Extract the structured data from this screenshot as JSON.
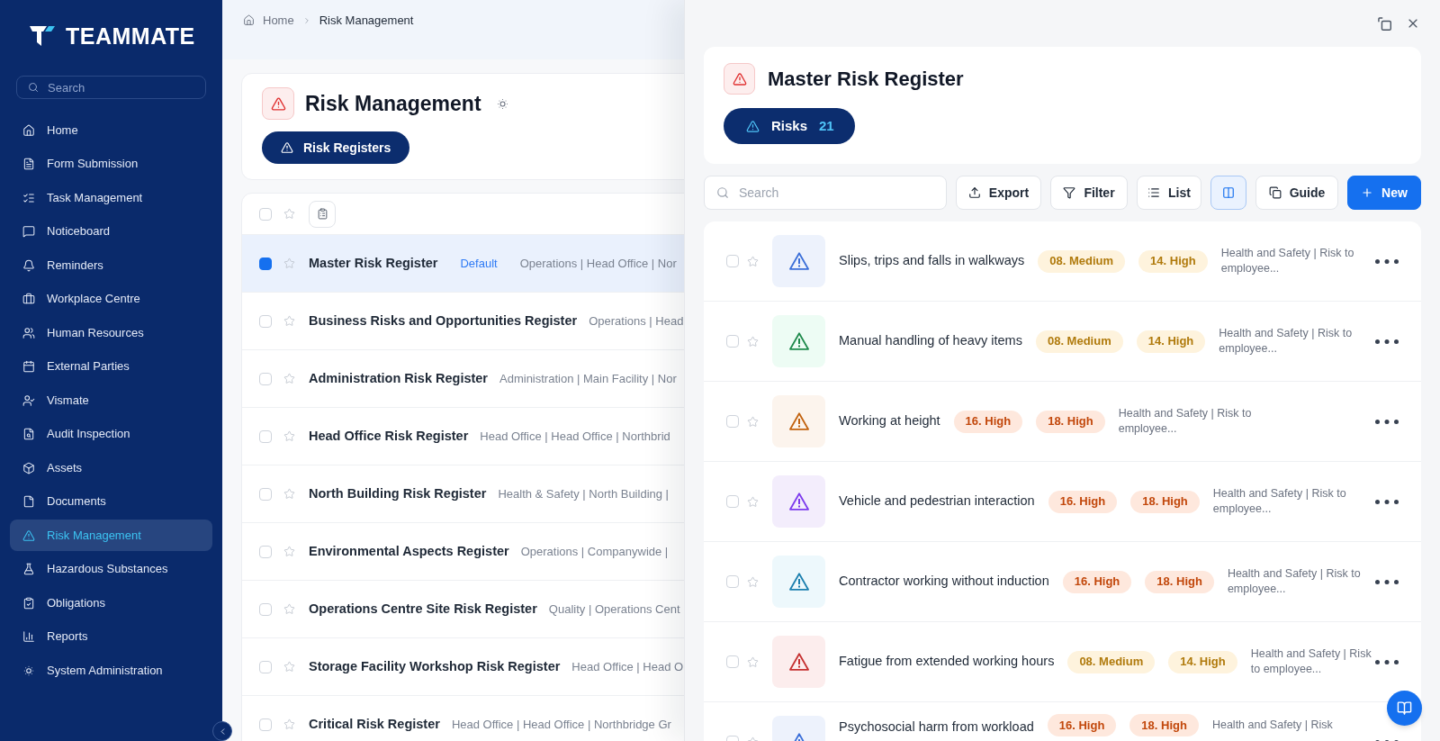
{
  "sidebar": {
    "logo": "TEAMMATE",
    "search": {
      "placeholder": "Search"
    },
    "items": [
      {
        "label": "Home",
        "selected": false
      },
      {
        "label": "Form Submission",
        "selected": false
      },
      {
        "label": "Task Management",
        "selected": false
      },
      {
        "label": "Noticeboard",
        "selected": false
      },
      {
        "label": "Reminders",
        "selected": false
      },
      {
        "label": "Workplace Centre",
        "selected": false
      },
      {
        "label": "Human Resources",
        "selected": false
      },
      {
        "label": "External Parties",
        "selected": false
      },
      {
        "label": "Vismate",
        "selected": false
      },
      {
        "label": "Audit Inspection",
        "selected": false
      },
      {
        "label": "Assets",
        "selected": false
      },
      {
        "label": "Documents",
        "selected": false
      },
      {
        "label": "Risk Management",
        "selected": true
      },
      {
        "label": "Hazardous Substances",
        "selected": false
      },
      {
        "label": "Obligations",
        "selected": false
      },
      {
        "label": "Reports",
        "selected": false
      },
      {
        "label": "System Administration",
        "selected": false
      }
    ]
  },
  "breadcrumbs": [
    "Home",
    "Risk Management"
  ],
  "page_header": {
    "title": "Risk Management",
    "tabs": [
      {
        "label": "Risk Registers",
        "selected": true
      }
    ]
  },
  "registers": {
    "select_all": {
      "checked": false
    },
    "rows": [
      {
        "name": "Master Risk Register",
        "tag": "Default",
        "meta": "Operations | Head Office | Nor",
        "selected": true,
        "checked": true
      },
      {
        "name": "Business Risks and Opportunities Register",
        "meta": "Operations | Head",
        "selected": false,
        "checked": false
      },
      {
        "name": "Administration Risk Register",
        "meta": "Administration | Main Facility | Nor",
        "selected": false,
        "checked": false
      },
      {
        "name": "Head Office Risk Register",
        "meta": "Head Office | Head Office | Northbrid",
        "selected": false,
        "checked": false
      },
      {
        "name": "North Building Risk Register",
        "meta": "Health & Safety | North Building |",
        "selected": false,
        "checked": false
      },
      {
        "name": "Environmental Aspects Register",
        "meta": "Operations | Companywide |",
        "selected": false,
        "checked": false
      },
      {
        "name": "Operations Centre Site Risk Register",
        "meta": "Quality | Operations Cent",
        "selected": false,
        "checked": false
      },
      {
        "name": "Storage Facility Workshop Risk Register",
        "meta": "Head Office | Head O",
        "selected": false,
        "checked": false
      },
      {
        "name": "Critical Risk Register",
        "meta": "Head Office | Head Office | Northbridge Gr",
        "selected": false,
        "checked": false
      }
    ]
  },
  "panel": {
    "title": "Master Risk Register",
    "tabs": [
      {
        "label": "Risks",
        "count": "21",
        "selected": true
      }
    ],
    "toolbar": {
      "search": {
        "placeholder": "Search"
      },
      "buttons": [
        {
          "kind": "export",
          "label": "Export"
        },
        {
          "kind": "filter",
          "label": "Filter"
        },
        {
          "kind": "list",
          "label": "List"
        },
        {
          "kind": "split_view",
          "on": true
        },
        {
          "kind": "guide",
          "label": "Guide"
        },
        {
          "kind": "new",
          "label": "New"
        }
      ]
    },
    "risks": [
      {
        "title": "Slips, trips and falls in walkways",
        "checked": false,
        "color": "#3b6fd8",
        "ratings": [
          {
            "label": "08. Medium",
            "color": "#b07a0c"
          },
          {
            "label": "14. High",
            "color": "#b07a0c"
          }
        ],
        "description": "Health and Safety | Risk to employee..."
      },
      {
        "title": "Manual handling of heavy items",
        "checked": false,
        "color": "#1f8a4c",
        "ratings": [
          {
            "label": "08. Medium",
            "color": "#b07a0c"
          },
          {
            "label": "14. High",
            "color": "#b07a0c"
          }
        ],
        "description": "Health and Safety | Risk to employee..."
      },
      {
        "title": "Working at height",
        "checked": false,
        "color": "#c2620f",
        "ratings": [
          {
            "label": "16. High",
            "color": "#c2480c"
          },
          {
            "label": "18. High",
            "color": "#c2480c"
          }
        ],
        "description": "Health and Safety | Risk to employee..."
      },
      {
        "title": "Vehicle and pedestrian interaction",
        "checked": false,
        "color": "#7c3aed",
        "ratings": [
          {
            "label": "16. High",
            "color": "#c2480c"
          },
          {
            "label": "18. High",
            "color": "#c2480c"
          }
        ],
        "description": "Health and Safety | Risk to employee..."
      },
      {
        "title": "Contractor working without induction",
        "checked": false,
        "color": "#1b7fae",
        "ratings": [
          {
            "label": "16. High",
            "color": "#c2480c"
          },
          {
            "label": "18. High",
            "color": "#c2480c"
          }
        ],
        "description": "Health and Safety | Risk to employee..."
      },
      {
        "title": "Fatigue from extended working hours",
        "checked": false,
        "color": "#c53030",
        "ratings": [
          {
            "label": "08. Medium",
            "color": "#b07a0c"
          },
          {
            "label": "14. High",
            "color": "#b07a0c"
          }
        ],
        "description": "Health and Safety | Risk to employee..."
      },
      {
        "title": "Psychosocial harm from workload",
        "checked": false,
        "color": "#3b6fd8",
        "ratings": [
          {
            "label": "16. High",
            "color": "#c2480c"
          },
          {
            "label": "18. High",
            "color": "#c2480c"
          }
        ],
        "description": "Health and Safety | Risk"
      }
    ]
  }
}
